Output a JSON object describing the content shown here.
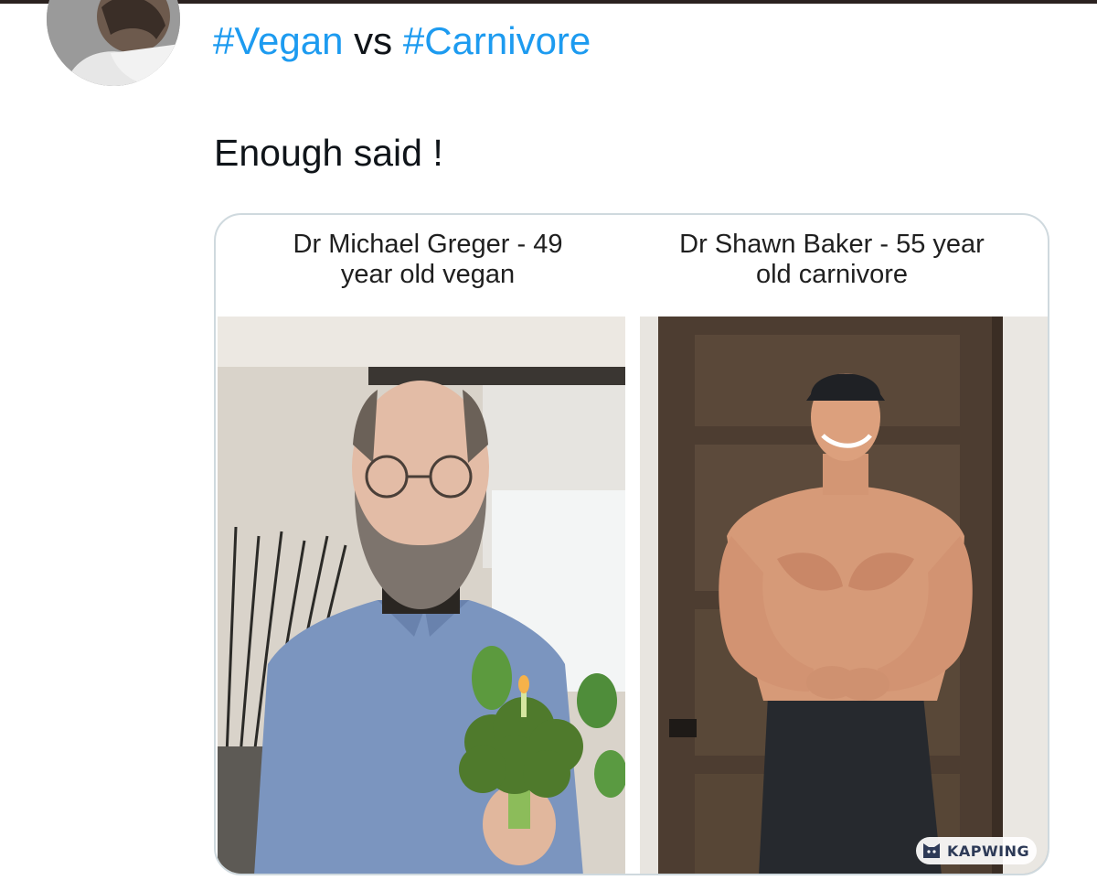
{
  "tweet": {
    "author_avatar_icon": "profile-avatar",
    "headline": {
      "hashtag_1": "#Vegan",
      "connector": "vs",
      "hashtag_2": "#Carnivore"
    },
    "text": "Enough said !"
  },
  "media": {
    "left": {
      "caption_line1": "Dr Michael Greger - 49",
      "caption_line2": "year old vegan"
    },
    "right": {
      "caption_line1": "Dr Shawn Baker - 55 year",
      "caption_line2": "old carnivore"
    },
    "watermark": "KAPWING"
  },
  "colors": {
    "link": "#1d9bf0",
    "text": "#0f1419",
    "card_border": "#cfd9de"
  }
}
